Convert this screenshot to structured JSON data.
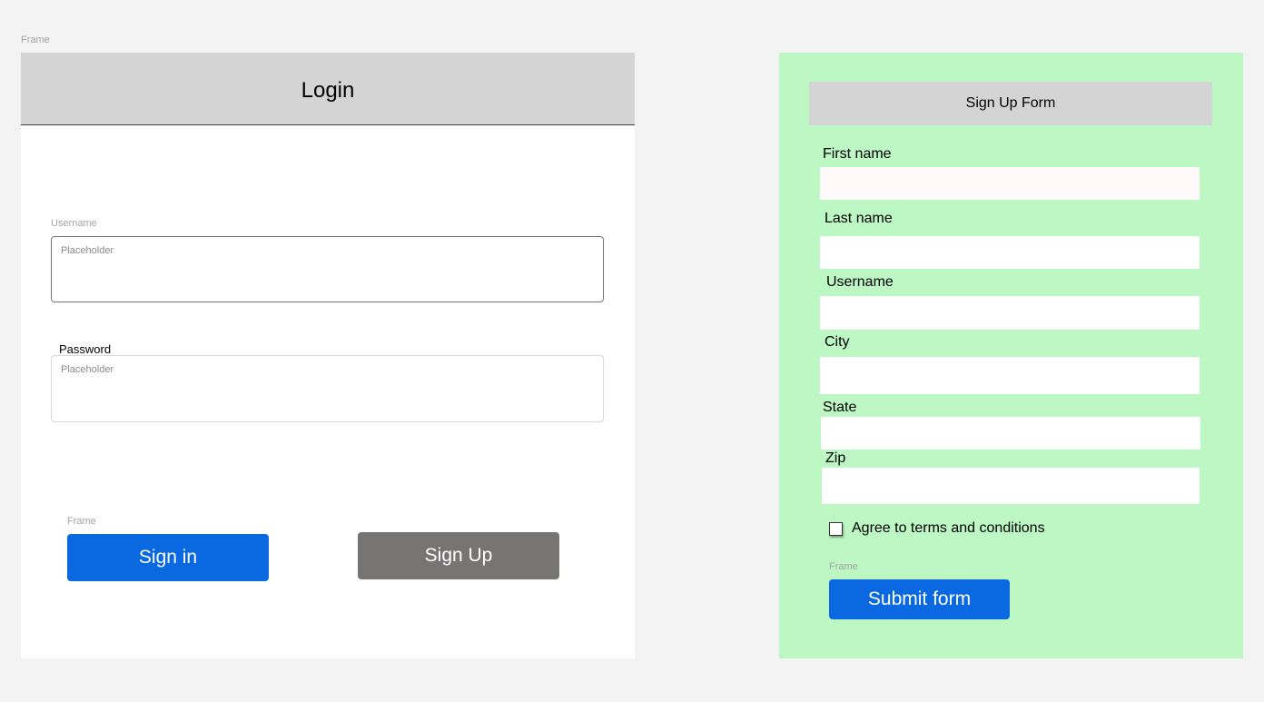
{
  "canvas": {
    "frame_label_top": "Frame"
  },
  "login": {
    "title": "Login",
    "username": {
      "label": "Username",
      "placeholder": "Placeholder"
    },
    "password": {
      "label": "Password",
      "placeholder": "Placeholder"
    },
    "buttons_frame_label": "Frame",
    "signin_label": "Sign in",
    "signup_label": "Sign Up"
  },
  "signup": {
    "title": "Sign Up Form",
    "fields": {
      "first_name": "First name",
      "last_name": "Last name",
      "username": "Username",
      "city": "City",
      "state": "State",
      "zip": "Zip"
    },
    "agree_label": "Agree to terms and conditions",
    "submit_frame_label": "Frame",
    "submit_label": "Submit form"
  },
  "colors": {
    "primary_button": "#0a68e0",
    "secondary_button": "#767574",
    "signup_background": "#bdf7c4",
    "header_background": "#d4d4d4"
  }
}
